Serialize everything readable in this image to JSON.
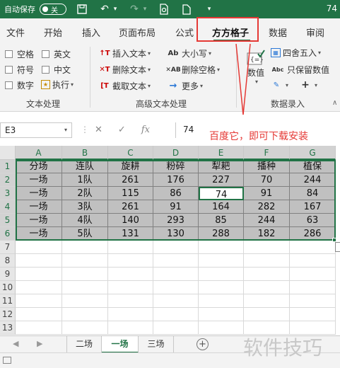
{
  "titlebar": {
    "autosave_label": "自动保存",
    "autosave_state": "关",
    "right_text": "74"
  },
  "ribbon_tabs": [
    "文件",
    "开始",
    "插入",
    "页面布局",
    "公式",
    "方方格子",
    "数据",
    "审阅"
  ],
  "active_tab_index": 5,
  "text_processing": {
    "checkboxes": [
      "空格",
      "英文",
      "符号",
      "中文",
      "数字"
    ],
    "execute_label": "执行",
    "group_label": "文本处理"
  },
  "advanced_text": {
    "buttons": [
      "插入文本",
      "删除文本",
      "截取文本",
      "大小写",
      "删除空格",
      "更多"
    ],
    "group_label": "高级文本处理"
  },
  "data_entry": {
    "value_label": "数值",
    "round_label": "四舍五入",
    "keep_value_label": "只保留数值",
    "group_label": "数据录入"
  },
  "formula_bar": {
    "name_box": "E3",
    "value": "74"
  },
  "annotation": "百度它，即可下载安装",
  "grid": {
    "columns": [
      "A",
      "B",
      "C",
      "D",
      "E",
      "F",
      "G"
    ],
    "row_numbers": [
      "1",
      "2",
      "3",
      "4",
      "5",
      "6",
      "7",
      "8",
      "9",
      "10",
      "11",
      "12",
      "13"
    ],
    "rows": [
      [
        "分场",
        "连队",
        "旋耕",
        "粉碎",
        "犁耙",
        "播种",
        "植保"
      ],
      [
        "一场",
        "1队",
        "261",
        "176",
        "227",
        "70",
        "244"
      ],
      [
        "一场",
        "2队",
        "115",
        "86",
        "74",
        "91",
        "84"
      ],
      [
        "一场",
        "3队",
        "261",
        "91",
        "164",
        "282",
        "167"
      ],
      [
        "一场",
        "4队",
        "140",
        "293",
        "85",
        "244",
        "63"
      ],
      [
        "一场",
        "5队",
        "131",
        "130",
        "288",
        "182",
        "286"
      ]
    ],
    "active_cell": "E3"
  },
  "sheets": [
    "二场",
    "一场",
    "三场"
  ],
  "active_sheet_index": 1,
  "watermark": "软件技巧",
  "colors": {
    "accent": "#217346",
    "highlight": "#e53935",
    "cell_shade": "#c0c0c0"
  }
}
